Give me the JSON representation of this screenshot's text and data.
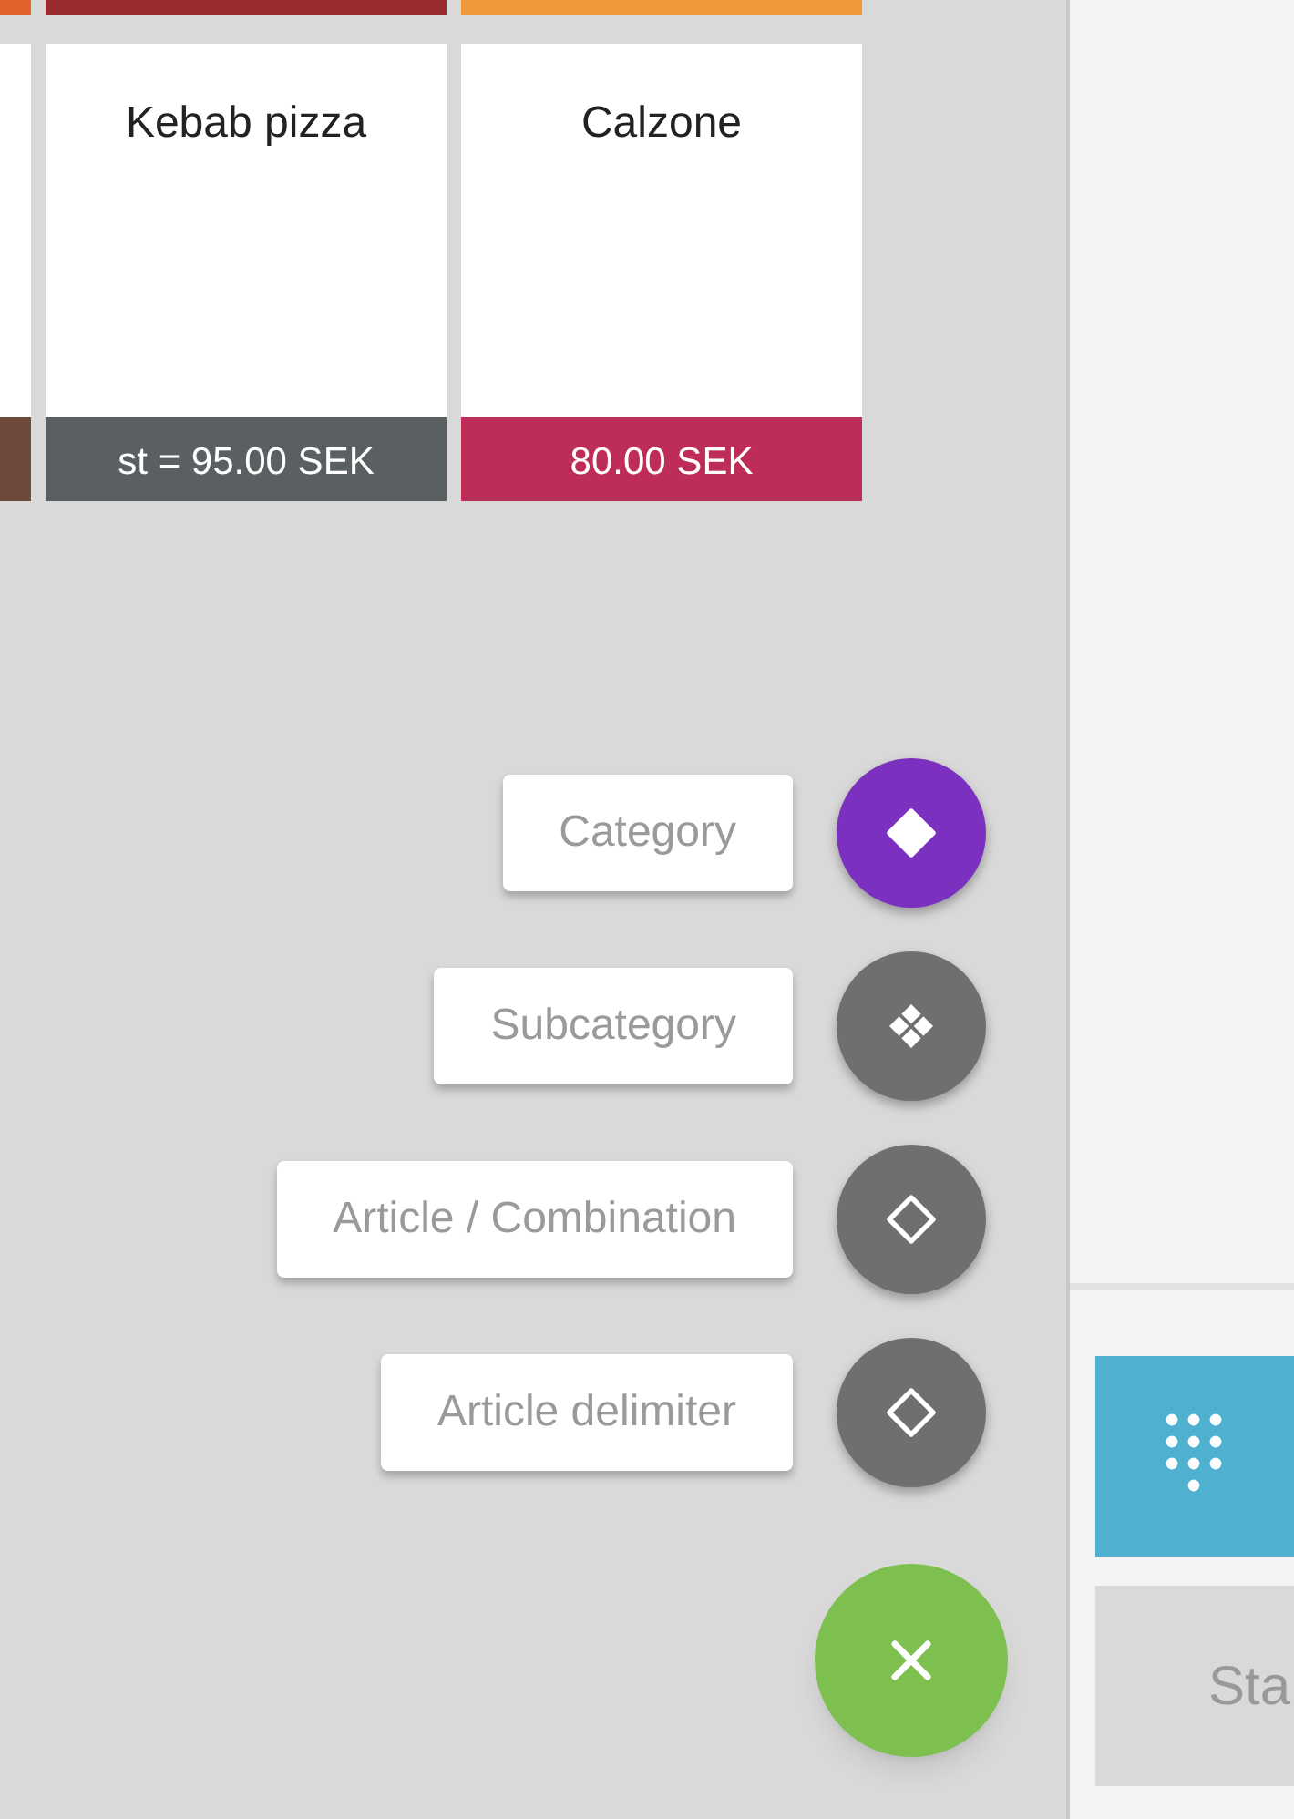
{
  "cut_cards": [
    {
      "color": "#e0632d"
    },
    {
      "color": "#9b2a2d"
    },
    {
      "color": "#ee9a3c"
    }
  ],
  "articles": [
    {
      "color": "#6e4a3c"
    },
    {
      "name": "Kebab pizza",
      "price": "st = 95.00 SEK",
      "color": "#5a5f62"
    },
    {
      "name": "Calzone",
      "price": "80.00 SEK",
      "color": "#bd2d58"
    }
  ],
  "speed_dial": [
    {
      "label": "Category",
      "kind": "solid",
      "color": "#7b30c0"
    },
    {
      "label": "Subcategory",
      "kind": "cluster",
      "color": "#6f6f6f"
    },
    {
      "label": "Article / Combination",
      "kind": "outline",
      "color": "#6f6f6f"
    },
    {
      "label": "Article delimiter",
      "kind": "outline",
      "color": "#6f6f6f"
    }
  ],
  "side_panel": {
    "start_button": "Sta"
  }
}
